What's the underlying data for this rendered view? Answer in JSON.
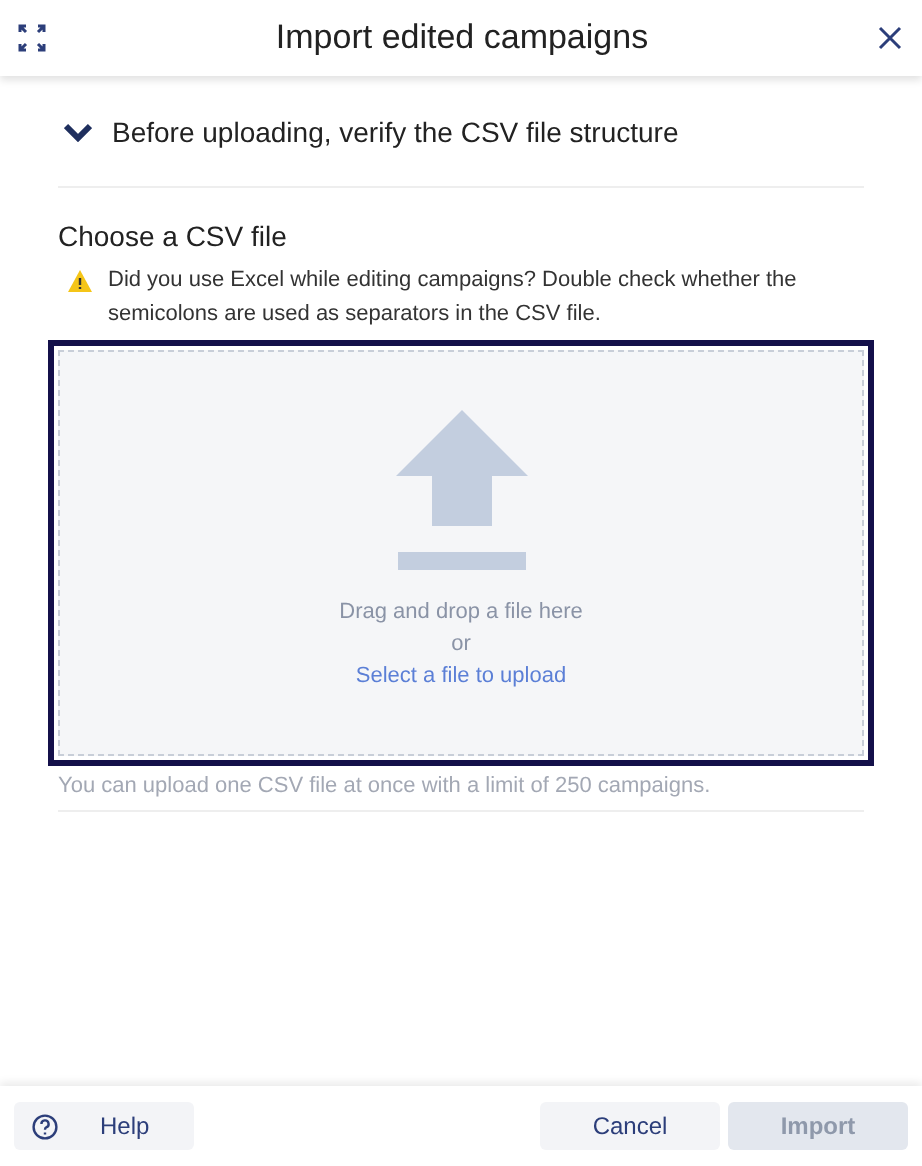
{
  "window": {
    "title": "Import edited campaigns"
  },
  "expander": {
    "label": "Before uploading, verify the CSV file structure",
    "expanded": false
  },
  "upload": {
    "heading": "Choose a CSV file",
    "warning": "Did you use Excel while editing campaigns? Double check whether the semicolons are used as separators in the CSV file.",
    "dropzone": {
      "focused": true,
      "prompt": "Drag and drop a file here",
      "separator": "or",
      "link": "Select a file to upload"
    },
    "hint": "You can upload one CSV file at once with a limit of 250 campaigns."
  },
  "footer": {
    "help": "Help",
    "buttons": [
      {
        "label": "Cancel",
        "disabled": false
      },
      {
        "label": "Import",
        "disabled": true
      }
    ]
  }
}
